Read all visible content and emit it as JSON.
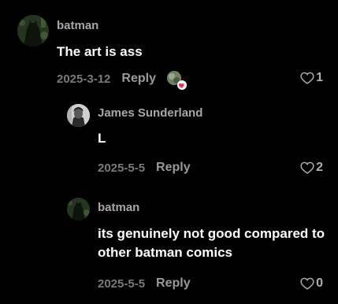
{
  "comments": [
    {
      "username": "batman",
      "text": "The art is ass",
      "date": "2025-3-12",
      "reply_label": "Reply",
      "likes": "1",
      "creator_liked": true,
      "avatar_icon": "batman-avatar"
    },
    {
      "username": "James Sunderland",
      "text": "L",
      "date": "2025-5-5",
      "reply_label": "Reply",
      "likes": "2",
      "avatar_icon": "james-avatar"
    },
    {
      "username": "batman",
      "text": "its genuinely not good compared to other batman comics",
      "date": "2025-5-5",
      "reply_label": "Reply",
      "likes": "0",
      "avatar_icon": "batman-avatar"
    }
  ],
  "colors": {
    "background": "#000000",
    "username": "#a8a8a8",
    "text": "#ffffff",
    "meta": "#7a7a7a",
    "badge_heart": "#fe2c55"
  }
}
